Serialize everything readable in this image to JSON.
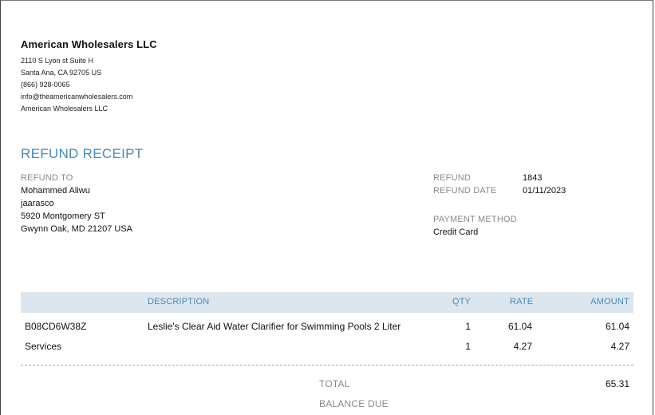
{
  "company": {
    "name": "American Wholesalers LLC",
    "address1": "2110 S Lyon st Suite H",
    "address2": "Santa Ana, CA  92705 US",
    "phone": "(866) 928-0065",
    "email": "info@theamericanwholesalers.com",
    "name_line": "American Wholesalers LLC"
  },
  "document": {
    "title": "REFUND RECEIPT"
  },
  "refund_to": {
    "label": "REFUND TO",
    "name": "Mohammed Aliwu",
    "company": "jaarasco",
    "street": "5920 Montgomery ST",
    "city": "Gwynn Oak, MD  21207 USA"
  },
  "refund_info": {
    "refund_label": "REFUND",
    "refund_number": "1843",
    "date_label": "REFUND DATE",
    "date": "01/11/2023",
    "payment_label": "PAYMENT METHOD",
    "payment_method": "Credit Card"
  },
  "table": {
    "headers": {
      "description": "DESCRIPTION",
      "qty": "QTY",
      "rate": "RATE",
      "amount": "AMOUNT"
    },
    "rows": [
      {
        "sku": "B08CD6W38Z",
        "description": "Leslie's Clear Aid Water Clarifier for Swimming Pools 2 Liter",
        "qty": "1",
        "rate": "61.04",
        "amount": "61.04"
      },
      {
        "sku": "Services",
        "description": "",
        "qty": "1",
        "rate": "4.27",
        "amount": "4.27"
      }
    ]
  },
  "totals": {
    "total_label": "TOTAL",
    "total": "65.31",
    "balance_label": "BALANCE DUE"
  }
}
